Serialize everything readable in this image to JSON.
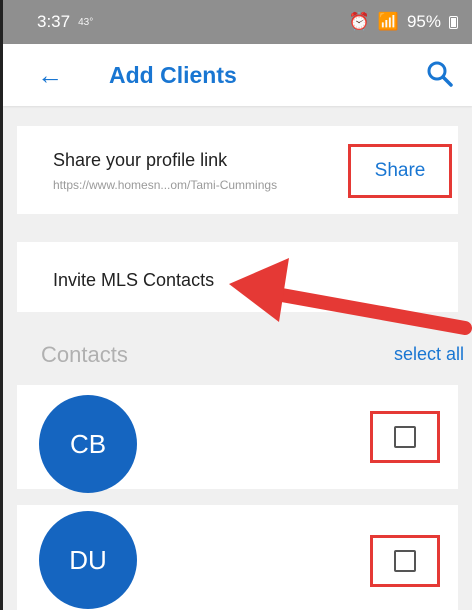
{
  "status_bar": {
    "time": "3:37",
    "temp": "43°",
    "battery": "95%"
  },
  "header": {
    "title": "Add Clients",
    "back_icon": "arrow-left-icon",
    "search_icon": "search-icon",
    "accent_color": "#1976d2"
  },
  "share_card": {
    "title": "Share your profile link",
    "url": "https://www.homesn...om/Tami-Cummings",
    "button_label": "Share"
  },
  "invite_card": {
    "label": "Invite MLS Contacts"
  },
  "contacts": {
    "header": "Contacts",
    "select_all_label": "select all",
    "items": [
      {
        "initials": "CB",
        "checked": false
      },
      {
        "initials": "DU",
        "checked": false
      }
    ]
  },
  "annotation": {
    "highlight_color": "#e53935"
  }
}
